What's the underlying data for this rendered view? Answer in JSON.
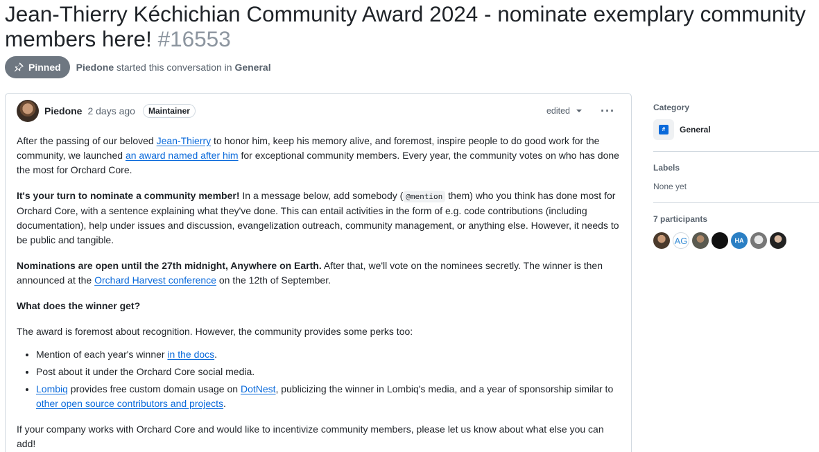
{
  "discussion": {
    "title": "Jean-Thierry Kéchichian Community Award 2024 - nominate exemplary community members here!",
    "number": "#16553",
    "pinned_label": "Pinned",
    "starter": "Piedone",
    "started_text": "started this conversation in",
    "category": "General"
  },
  "post": {
    "author": "Piedone",
    "time": "2 days ago",
    "role_badge": "Maintainer",
    "edited_label": "edited",
    "more_label": "···",
    "p1": {
      "t1": "After the passing of our beloved ",
      "link1": "Jean-Thierry",
      "t2": " to honor him, keep his memory alive, and foremost, inspire people to do good work for the community, we launched ",
      "link2": "an award named after him",
      "t3": " for exceptional community members. Every year, the community votes on who has done the most for Orchard Core."
    },
    "p2": {
      "bold": "It's your turn to nominate a community member!",
      "t1": " In a message below, add somebody (",
      "code": "@mention",
      "t2": " them) who you think has done most for Orchard Core, with a sentence explaining what they've done. This can entail activities in the form of e.g. code contributions (including documentation), help under issues and discussion, evangelization outreach, community management, or anything else. However, it needs to be public and tangible."
    },
    "p3": {
      "bold": "Nominations are open until the 27th midnight, Anywhere on Earth.",
      "t1": " After that, we'll vote on the nominees secretly. The winner is then announced at the ",
      "link": "Orchard Harvest conference",
      "t2": " on the 12th of September."
    },
    "h_winner": "What does the winner get?",
    "p4": "The award is foremost about recognition. However, the community provides some perks too:",
    "list": {
      "i1_t": "Mention of each year's winner ",
      "i1_link": "in the docs",
      "i1_end": ".",
      "i2": "Post about it under the Orchard Core social media.",
      "i3_link1": "Lombiq",
      "i3_t1": " provides free custom domain usage on ",
      "i3_link2": "DotNest",
      "i3_t2": ", publicizing the winner in Lombiq's media, and a year of sponsorship similar to ",
      "i3_link3": "other open source contributors and projects",
      "i3_end": "."
    },
    "p5": "If your company works with Orchard Core and would like to incentivize community members, please let us know about what else you can add!"
  },
  "sidebar": {
    "category_label": "Category",
    "category_value": "General",
    "labels_label": "Labels",
    "labels_value": "None yet",
    "participants_label": "7 participants",
    "participants": [
      "P1",
      "AG",
      "P3",
      "P4",
      "HA",
      "P6",
      "P7"
    ]
  },
  "colors": {
    "link": "#0969da",
    "pinned_bg": "#6e7781",
    "muted": "#59636e"
  }
}
